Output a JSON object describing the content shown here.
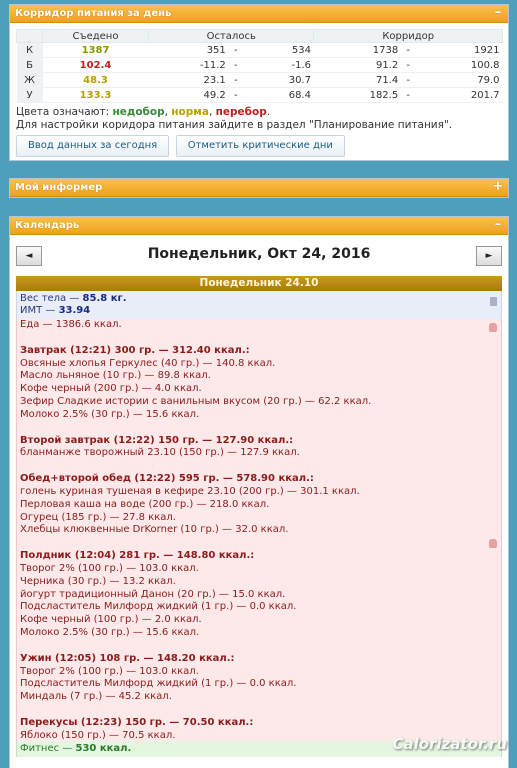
{
  "corridor": {
    "title": "Корридор питания за день",
    "toggle": "–",
    "headers": {
      "eaten": "Съедено",
      "remaining": "Осталось",
      "corridor": "Корридор"
    },
    "rows": [
      {
        "label": "К",
        "eaten": "1387",
        "eaten_color": "#8a9a00",
        "rem_min": "351",
        "rem_max": "534",
        "cor_min": "1738",
        "cor_max": "1921"
      },
      {
        "label": "Б",
        "eaten": "102.4",
        "eaten_color": "#c02020",
        "rem_min": "-11.2",
        "rem_max": "-1.6",
        "cor_min": "91.2",
        "cor_max": "100.8"
      },
      {
        "label": "Ж",
        "eaten": "48.3",
        "eaten_color": "#b8a000",
        "rem_min": "23.1",
        "rem_max": "30.7",
        "cor_min": "71.4",
        "cor_max": "79.0"
      },
      {
        "label": "У",
        "eaten": "133.3",
        "eaten_color": "#b8a000",
        "rem_min": "49.2",
        "rem_max": "68.4",
        "cor_min": "182.5",
        "cor_max": "201.7"
      }
    ],
    "dash": "-",
    "legend_prefix": "Цвета означают: ",
    "legend_under": "недобор",
    "legend_norm": "норма",
    "legend_over": "перебор",
    "legend_note": "Для настройки коридора питания зайдите в раздел \"Планирование питания\".",
    "btn_today": "Ввод данных за сегодня",
    "btn_critical": "Отметить критические дни"
  },
  "informer": {
    "title": "Мой информер",
    "toggle": "+"
  },
  "calendar": {
    "title": "Календарь",
    "toggle": "–",
    "prev": "◄",
    "next": "►",
    "date_title": "Понедельник, Окт 24, 2016",
    "day_header": "Понедельник 24.10",
    "weight_label": "Вес тела — ",
    "weight_value": "85.8 кг.",
    "bmi_label": "ИМТ — ",
    "bmi_value": "33.94",
    "food_total": "Еда — 1386.6 ккал.",
    "meals": [
      {
        "title": "Завтрак (12:21) 300 гр. — 312.40 ккал.:",
        "items": [
          "Овсяные хлопья Геркулес (40 гр.) — 140.8 ккал.",
          "Масло льняное (10 гр.) — 89.8 ккал.",
          "Кофе черный (200 гр.) — 4.0 ккал.",
          "Зефир Сладкие истории с ванильным вкусом (20 гр.) — 62.2 ккал.",
          "Молоко 2.5% (30 гр.) — 15.6 ккал."
        ]
      },
      {
        "title": "Второй завтрак (12:22) 150 гр. — 127.90 ккал.:",
        "items": [
          "бланманже творожный 23.10 (150 гр.) — 127.9 ккал."
        ]
      },
      {
        "title": "Обед+второй обед (12:22) 595 гр. — 578.90 ккал.:",
        "items": [
          "голень куриная тушеная в кефире 23.10 (200 гр.) — 301.1 ккал.",
          "Перловая каша на воде (200 гр.) — 218.0 ккал.",
          "Огурец (185 гр.) — 27.8 ккал.",
          "Хлебцы клюквенные DrKorner (10 гр.) — 32.0 ккал."
        ]
      },
      {
        "title": "Полдник (12:04) 281 гр. — 148.80 ккал.:",
        "items": [
          "Творог 2% (100 гр.) — 103.0 ккал.",
          "Черника (30 гр.) — 13.2 ккал.",
          "йогурт традиционный Данон (20 гр.) — 15.0 ккал.",
          "Подсластитель Милфорд жидкий (1 гр.) — 0.0 ккал.",
          "Кофе черный (100 гр.) — 2.0 ккал.",
          "Молоко 2.5% (30 гр.) — 15.6 ккал."
        ]
      },
      {
        "title": "Ужин (12:05) 108 гр. — 148.20 ккал.:",
        "items": [
          "Творог 2% (100 гр.) — 103.0 ккал.",
          "Подсластитель Милфорд жидкий (1 гр.) — 0.0 ккал.",
          "Миндаль (7 гр.) — 45.2 ккал."
        ]
      },
      {
        "title": "Перекусы (12:23) 150 гр. — 70.50 ккал.:",
        "items": [
          "Яблоко (150 гр.) — 70.5 ккал."
        ]
      }
    ],
    "fitness_label": "Фитнес — ",
    "fitness_value": "530 ккал."
  },
  "watermark": "Calorizator.ru"
}
